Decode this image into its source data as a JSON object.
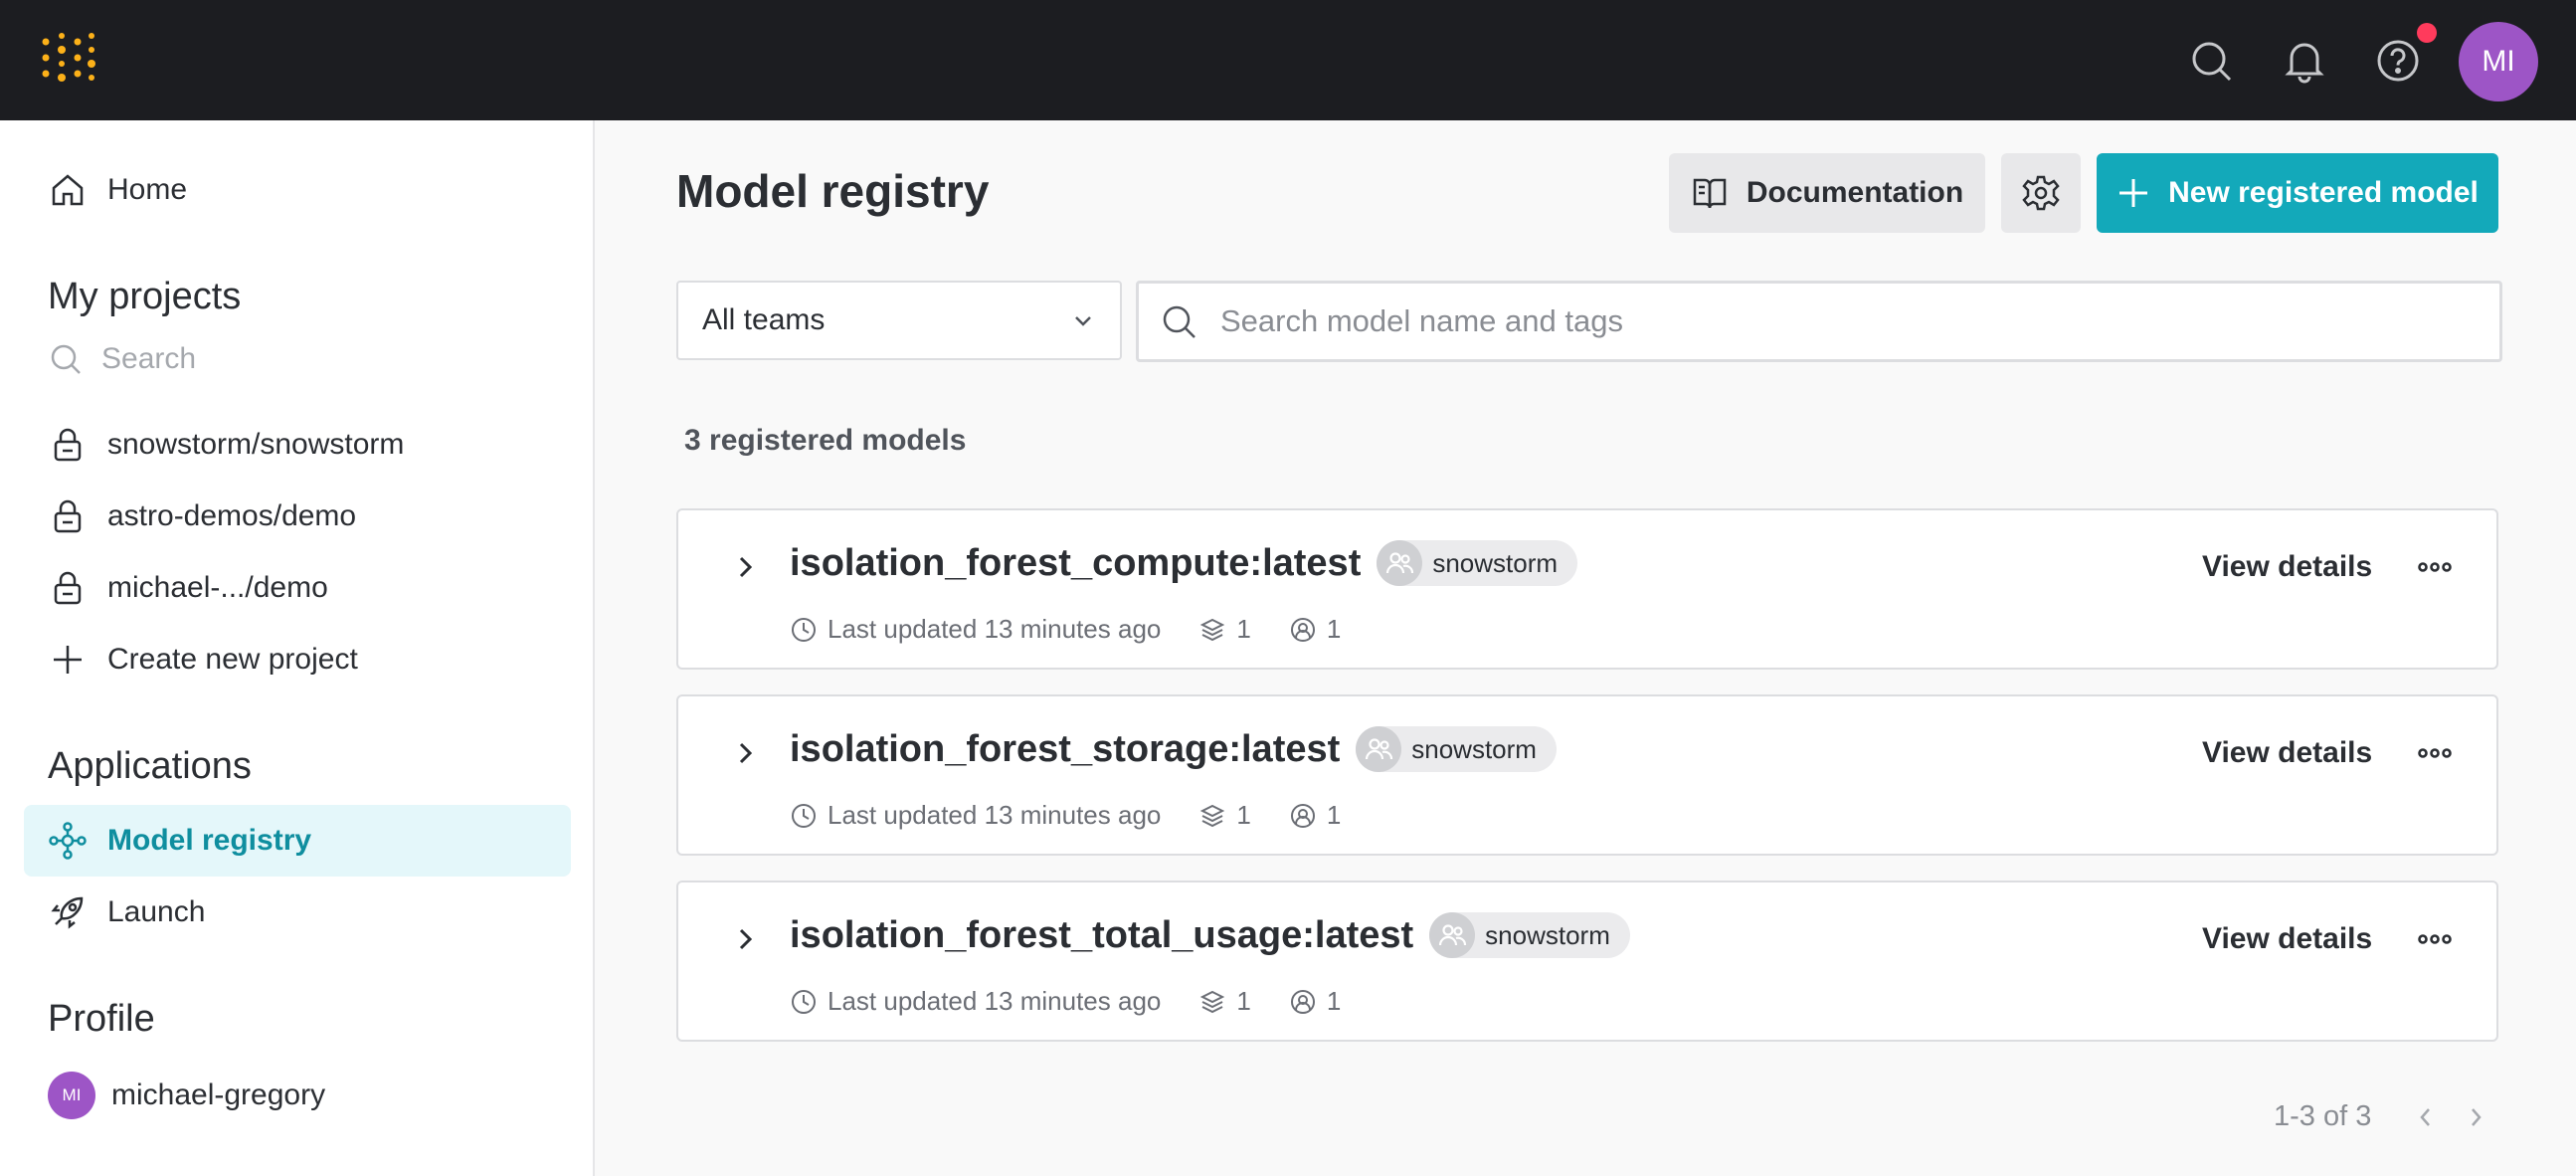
{
  "topbar": {
    "user_initials": "MI",
    "icons": [
      "search-icon",
      "bell-icon",
      "help-icon"
    ],
    "notification_dot_color": "#ff3b5c"
  },
  "sidebar": {
    "home_label": "Home",
    "my_projects_title": "My projects",
    "search_placeholder": "Search",
    "projects": [
      {
        "label": "snowstorm/snowstorm",
        "icon": "lock-icon"
      },
      {
        "label": "astro-demos/demo",
        "icon": "lock-icon"
      },
      {
        "label": "michael-.../demo",
        "icon": "lock-icon"
      }
    ],
    "create_project_label": "Create new project",
    "applications_title": "Applications",
    "applications": [
      {
        "label": "Model registry",
        "icon": "model-registry-icon",
        "active": true
      },
      {
        "label": "Launch",
        "icon": "rocket-icon",
        "active": false
      }
    ],
    "profile_title": "Profile",
    "profile_name": "michael-gregory",
    "profile_initials": "MI"
  },
  "main": {
    "title": "Model registry",
    "documentation_label": "Documentation",
    "new_model_label": "New registered model",
    "team_filter_value": "All teams",
    "search_placeholder": "Search model name and tags",
    "count_label": "3 registered models",
    "models": [
      {
        "name": "isolation_forest_compute:latest",
        "team": "snowstorm",
        "updated": "Last updated 13 minutes ago",
        "versions": "1",
        "users": "1",
        "view_label": "View details"
      },
      {
        "name": "isolation_forest_storage:latest",
        "team": "snowstorm",
        "updated": "Last updated 13 minutes ago",
        "versions": "1",
        "users": "1",
        "view_label": "View details"
      },
      {
        "name": "isolation_forest_total_usage:latest",
        "team": "snowstorm",
        "updated": "Last updated 13 minutes ago",
        "versions": "1",
        "users": "1",
        "view_label": "View details"
      }
    ],
    "pagination_label": "1-3 of 3"
  },
  "colors": {
    "topbar": "#1c1d21",
    "accent": "#13a9ba",
    "active_nav_bg": "#e4f7fa",
    "avatar": "#9d55c6",
    "logo": "#fcb119"
  }
}
